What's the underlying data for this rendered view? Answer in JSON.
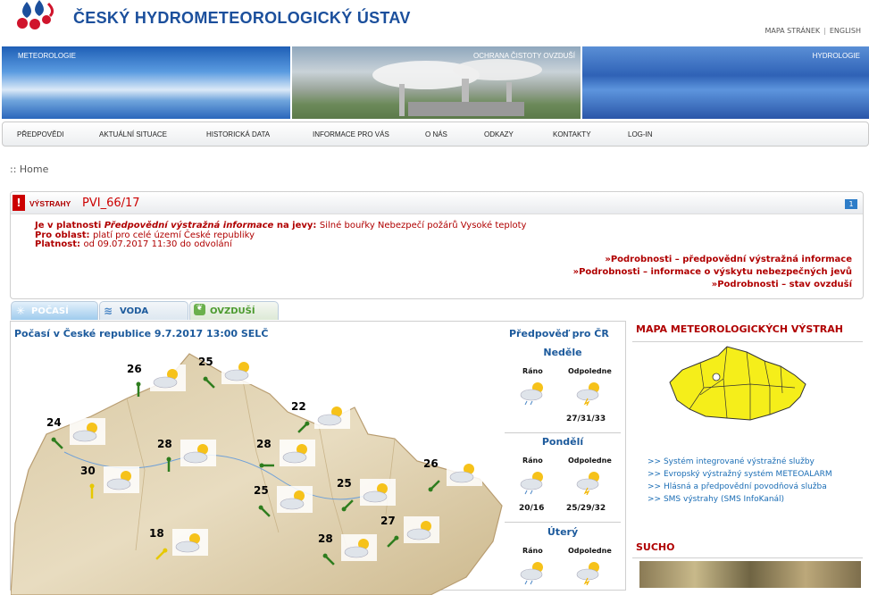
{
  "header": {
    "title": "ČESKÝ HYDROMETEOROLOGICKÝ ÚSTAV",
    "links": [
      "MAPA STRÁNEK",
      "ENGLISH"
    ]
  },
  "banners": [
    {
      "label": "METEOROLOGIE"
    },
    {
      "label": "OCHRANA ČISTOTY OVZDUŠÍ"
    },
    {
      "label": "HYDROLOGIE"
    }
  ],
  "nav": [
    "PŘEDPOVĚDI",
    "AKTUÁLNÍ SITUACE",
    "HISTORICKÁ DATA",
    "INFORMACE PRO VÁS",
    "O NÁS",
    "ODKAZY",
    "KONTAKTY",
    "LOG-IN"
  ],
  "breadcrumb": ":: Home",
  "warning": {
    "label": "VÝSTRAHY",
    "code": "PVI_66/17",
    "page_num": "1",
    "line1_prefix": "Je v platnosti ",
    "line1_emph": "Předpovědní výstražná informace",
    "line1_mid": " na jevy: ",
    "line1_value": "Silné bouřky Nebezpečí požárů Vysoké teploty",
    "line2_label": "Pro oblast: ",
    "line2_value": "platí pro celé území České republiky",
    "line3_label": "Platnost: ",
    "line3_value": "od 09.07.2017 11:30 do odvolání",
    "details": [
      "Podrobnosti – předpovědní výstražná informace",
      "Podrobnosti – informace o výskytu nebezpečných jevů",
      "Podrobnosti – stav ovzduší"
    ]
  },
  "tabs": [
    "POČASÍ",
    "VODA",
    "OVZDUŠÍ"
  ],
  "weather": {
    "title": "Počasí v České republice 9.7.2017 13:00 SELČ",
    "stations": [
      {
        "temp": "26",
        "wind": "n"
      },
      {
        "temp": "25",
        "wind": "nw"
      },
      {
        "temp": "22",
        "wind": "ne"
      },
      {
        "temp": "24",
        "wind": "nw"
      },
      {
        "temp": "28",
        "wind": "n"
      },
      {
        "temp": "28",
        "wind": "w"
      },
      {
        "temp": "30",
        "wind": "n"
      },
      {
        "temp": "26",
        "wind": "sw"
      },
      {
        "temp": "25",
        "wind": "nw"
      },
      {
        "temp": "25",
        "wind": "sw"
      },
      {
        "temp": "18",
        "wind": "ne"
      },
      {
        "temp": "28",
        "wind": "nw"
      },
      {
        "temp": "27",
        "wind": "ne"
      }
    ]
  },
  "forecast": {
    "title": "Předpověď pro ČR",
    "days": [
      {
        "name": "Neděle",
        "morning": "Ráno",
        "afternoon": "Odpoledne",
        "morning_val": "",
        "afternoon_val": "27/31/33"
      },
      {
        "name": "Pondělí",
        "morning": "Ráno",
        "afternoon": "Odpoledne",
        "morning_val": "20/16",
        "afternoon_val": "25/29/32"
      },
      {
        "name": "Úterý",
        "morning": "Ráno",
        "afternoon": "Odpoledne",
        "morning_val": "",
        "afternoon_val": ""
      }
    ]
  },
  "sidebar": {
    "map_title": "MAPA METEOROLOGICKÝCH VÝSTRAH",
    "links": [
      "Systém integrované výstražné služby",
      "Evropský výstražný systém METEOALARM",
      "Hlásná a předpovědní povodňová služba",
      "SMS výstrahy (SMS InfoKanál)"
    ],
    "sucho_title": "SUCHO"
  },
  "colors": {
    "brand_blue": "#1b4f9c",
    "warning_red": "#b00000",
    "link_blue": "#1a6db5",
    "map_yellow": "#f5ee1a"
  }
}
